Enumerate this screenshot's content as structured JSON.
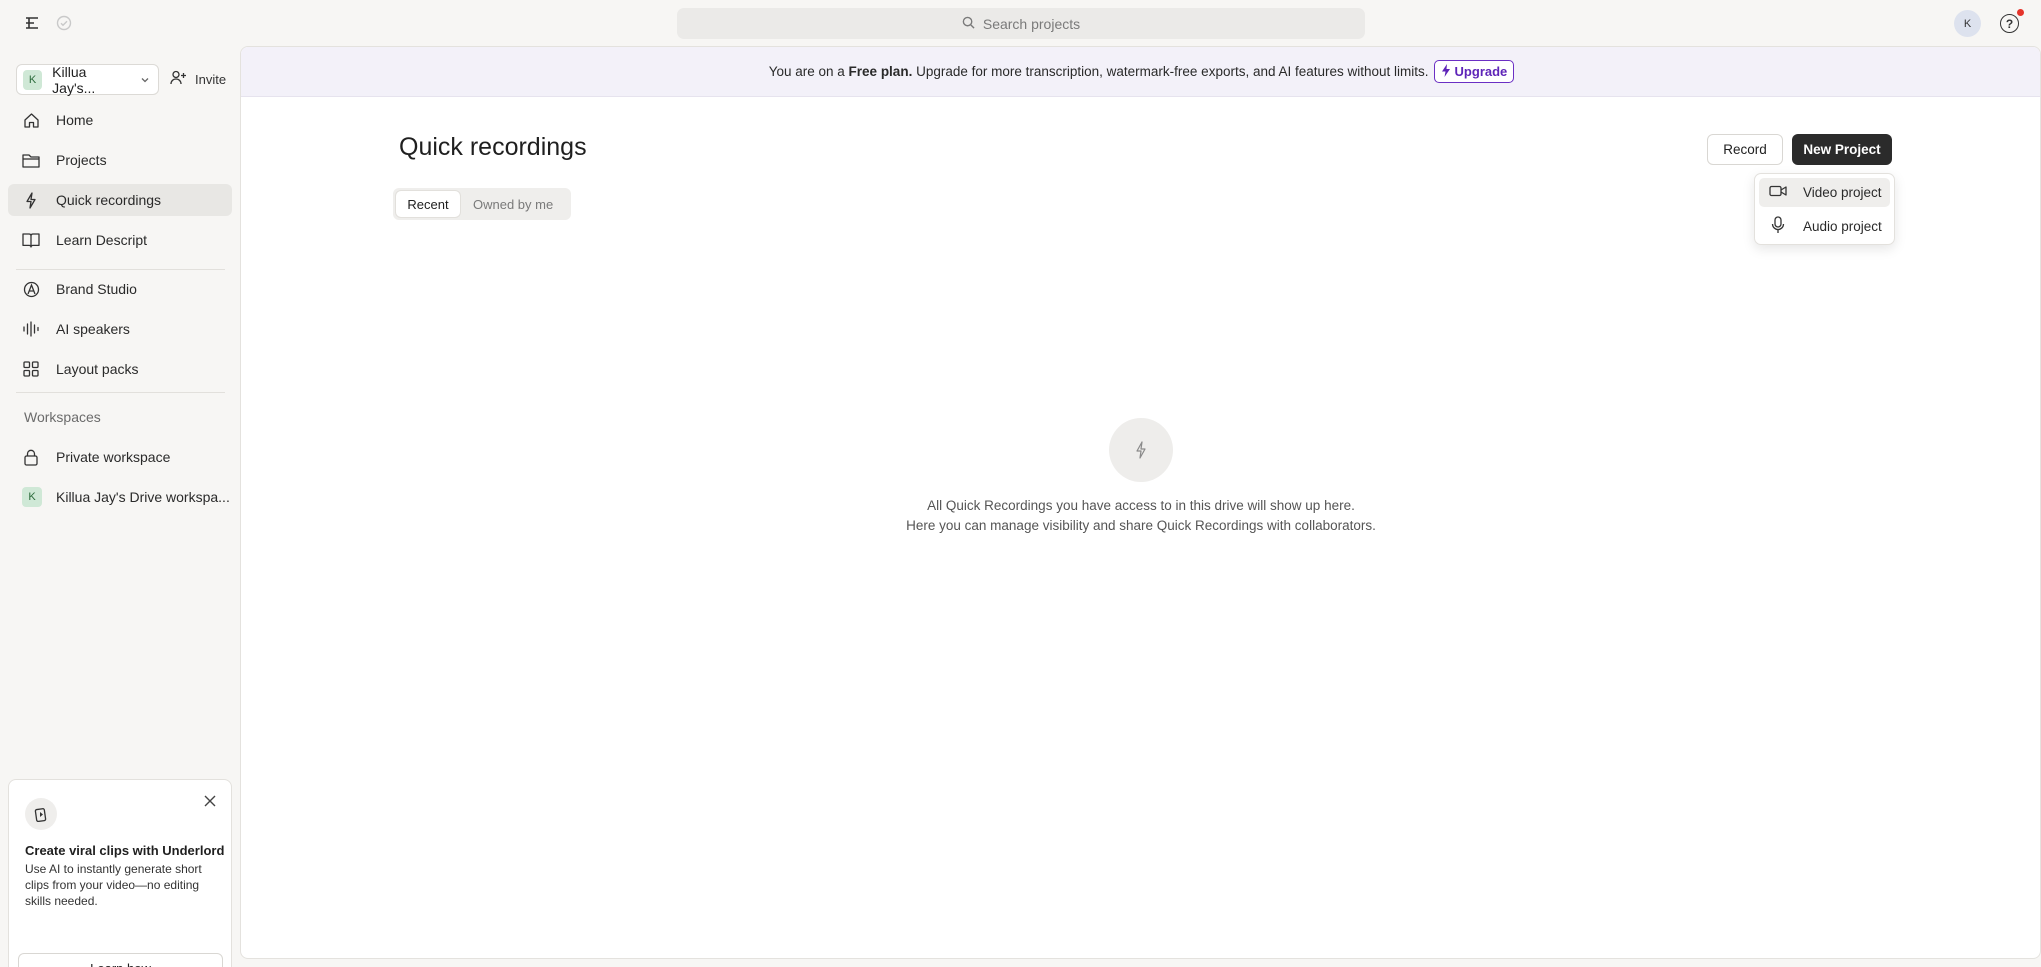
{
  "topbar": {
    "search_placeholder": "Search projects",
    "avatar_initial": "K",
    "help_label": "?"
  },
  "sidebar": {
    "workspace_name": "Killua Jay's...",
    "workspace_initial": "K",
    "invite_label": "Invite",
    "items": [
      {
        "label": "Home",
        "icon": "home-icon"
      },
      {
        "label": "Projects",
        "icon": "folder-icon"
      },
      {
        "label": "Quick recordings",
        "icon": "bolt-icon",
        "active": true
      },
      {
        "label": "Learn Descript",
        "icon": "book-icon"
      },
      {
        "label": "Brand Studio",
        "icon": "brand-icon"
      },
      {
        "label": "AI speakers",
        "icon": "waveform-icon"
      },
      {
        "label": "Layout packs",
        "icon": "grid-icon"
      }
    ],
    "workspaces_label": "Workspaces",
    "workspaces": [
      {
        "label": "Private workspace",
        "icon": "lock-icon"
      },
      {
        "label": "Killua Jay's Drive workspa...",
        "initial": "K"
      }
    ],
    "promo": {
      "title": "Create viral clips with Underlord",
      "body": "Use AI to instantly generate short clips from your video—no editing skills needed.",
      "button": "Learn how"
    }
  },
  "banner": {
    "prefix": "You are on a ",
    "plan": "Free plan.",
    "suffix": " Upgrade for more transcription, watermark-free exports, and AI features without limits.",
    "upgrade_label": "Upgrade"
  },
  "main": {
    "title": "Quick recordings",
    "tabs": [
      {
        "label": "Recent",
        "active": true
      },
      {
        "label": "Owned by me",
        "active": false
      }
    ],
    "record_label": "Record",
    "new_project_label": "New Project",
    "dropdown": [
      {
        "label": "Video project",
        "icon": "video-camera-icon"
      },
      {
        "label": "Audio project",
        "icon": "microphone-icon"
      }
    ],
    "empty_line1": "All Quick Recordings you have access to in this drive will show up here.",
    "empty_line2": "Here you can manage visibility and share Quick Recordings with collaborators."
  },
  "colors": {
    "accent_purple": "#6b2fc4",
    "primary_dark": "#2b2b2b",
    "banner_bg": "#f3f1f9",
    "notification_red": "#e5332a"
  }
}
